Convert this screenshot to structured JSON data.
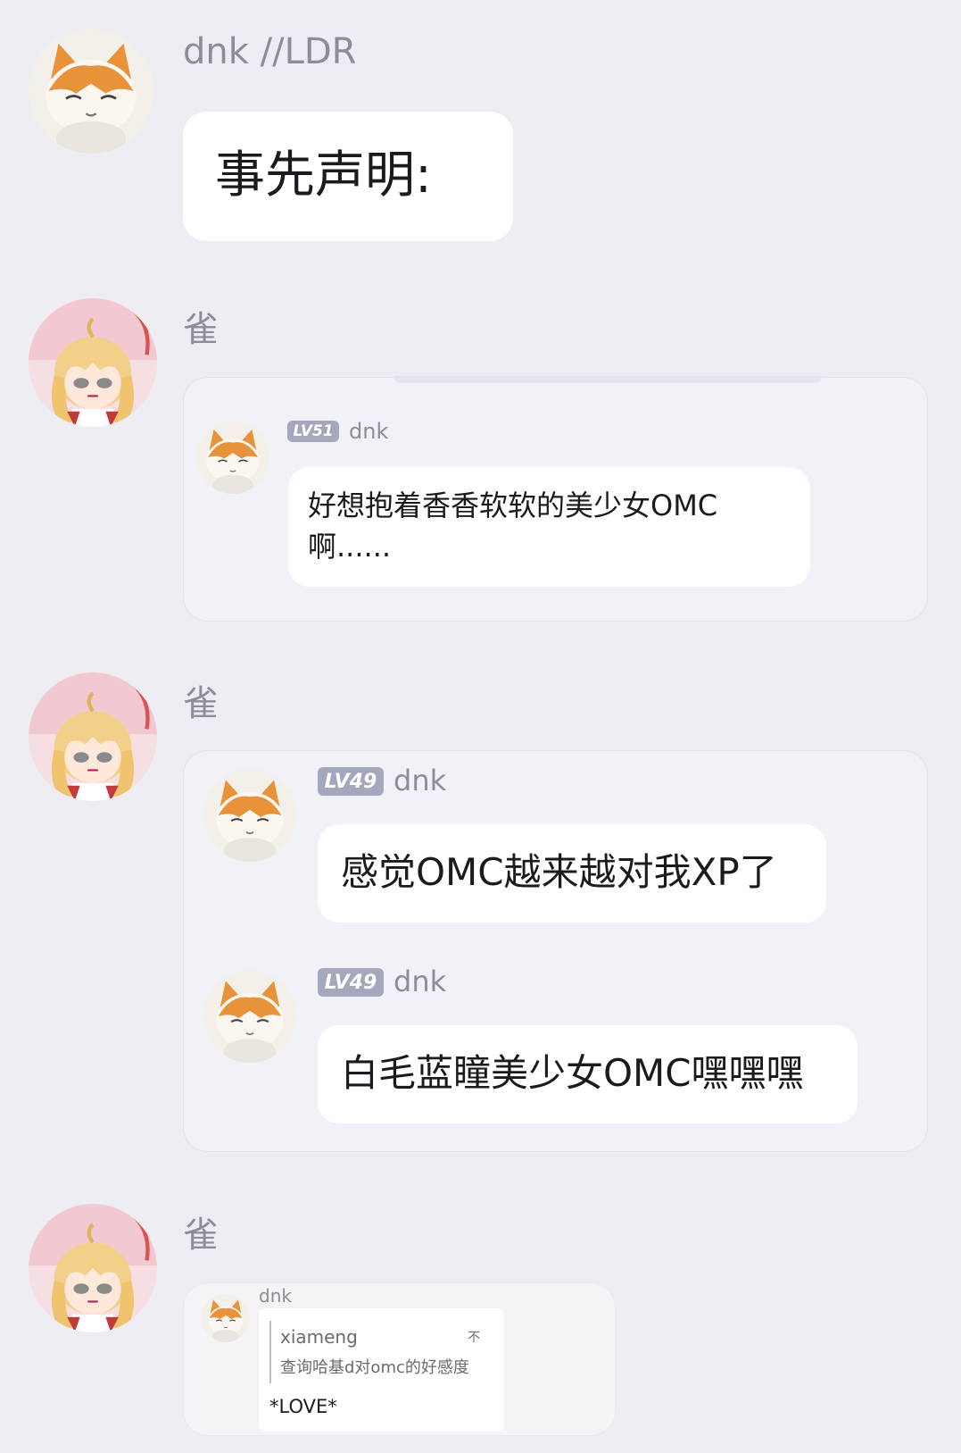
{
  "messages": [
    {
      "sender": "dnk //LDR",
      "text": "事先声明:"
    },
    {
      "sender": "雀",
      "quote": {
        "level": "LV51",
        "name": "dnk",
        "text_line1": "好想抱着香香软软的美少女OMC",
        "text_line2": "啊......"
      }
    },
    {
      "sender": "雀",
      "quotes": [
        {
          "level": "LV49",
          "name": "dnk",
          "text": "感觉OMC越来越对我XP了"
        },
        {
          "level": "LV49",
          "name": "dnk",
          "text": "白毛蓝瞳美少女OMC嘿嘿嘿"
        }
      ]
    },
    {
      "sender": "雀",
      "forward": {
        "name": "dnk",
        "reply_user": "xiameng",
        "reply_mark": "不",
        "reply_text": "查询哈基d对omc的好感度",
        "text": "*LOVE*"
      }
    }
  ],
  "colors": {
    "background": "#ededf3",
    "bubble": "#ffffff",
    "card": "#f1f1f7",
    "badge": "#a5a8bd",
    "name": "#8d8d95"
  },
  "icons": {
    "cat_avatar": "cat-avatar-icon",
    "girl_avatar": "anime-girl-avatar-icon"
  }
}
